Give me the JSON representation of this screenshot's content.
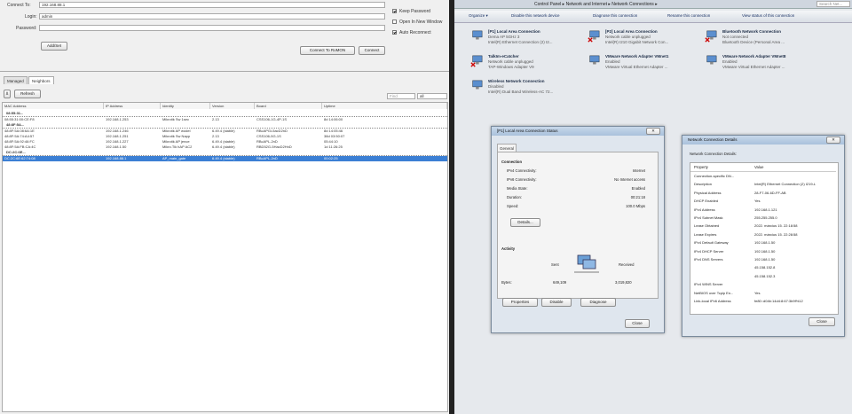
{
  "winbox": {
    "connect_to_label": "Connect To:",
    "connect_to_value": "192.168.88.1",
    "login_label": "Login:",
    "login_value": "admin",
    "password_label": "Password:",
    "password_value": "",
    "add_set_label": "Add/Set",
    "keep_password": "Keep Password",
    "open_new_window": "Open In New Window",
    "auto_reconnect": "Auto Reconnect",
    "connect_romon": "Connect To RoMON",
    "connect": "Connect",
    "tabs": [
      "Managed",
      "Neighbors"
    ],
    "refresh": "Refresh",
    "find_placeholder": "Find",
    "filter_value": "all",
    "columns": [
      "MAC Address",
      "IP Address",
      "Identity",
      "Version",
      "Board",
      "Uptime"
    ],
    "groups": [
      {
        "label": "08:55:31...",
        "rows": [
          {
            "mac": "08:55:31:00:CE:F8",
            "ip": "192.168.1.253",
            "identity": "Mikrotik Sw 1sec",
            "version": "2.13",
            "board": "CSS106-1G-4P-1S",
            "uptime": "8d 14:06:00",
            "selected": false
          }
        ]
      },
      {
        "label": "48:8F:5A...",
        "rows": [
          {
            "mac": "48:8F:5A:08:6A:1E",
            "ip": "192.168.1.246",
            "identity": "Mikrotik AP wodel",
            "version": "6.49.4 (stable)",
            "board": "RBcAPGi-5acD2nD",
            "uptime": "8d 14:05:46",
            "selected": false
          },
          {
            "mac": "48:8F:5A:74:A4:57",
            "ip": "192.168.1.251",
            "identity": "Mikrotik Sw Napp",
            "version": "2.13",
            "board": "CSS106-5G-1S",
            "uptime": "38d 03:50:07",
            "selected": false
          },
          {
            "mac": "48:8F:5A:92:46:FC",
            "ip": "192.168.1.227",
            "identity": "Mikrotik AP jence",
            "version": "6.49.4 (stable)",
            "board": "RBcAPL-2nD",
            "uptime": "05:44:10",
            "selected": false
          },
          {
            "mac": "48:8F:5A:FB:CA:4C",
            "ip": "192.168.1.50",
            "identity": "Mikro.Tik hAP AC2",
            "version": "6.49.4 (stable)",
            "board": "RBD52G-5HacD2HnD",
            "uptime": "1d 11:26:25",
            "selected": false
          }
        ]
      },
      {
        "label": "DC:2C:6E...",
        "rows": [
          {
            "mac": "DC:2C:6E:62:74:08",
            "ip": "192.168.88.1",
            "identity": "AP_main_gate",
            "version": "6.49.4 (stable)",
            "board": "RBcAPL-2nD",
            "uptime": "00:02:25",
            "selected": true
          }
        ]
      }
    ]
  },
  "explorer": {
    "address": "Control Panel  ▸  Network and Internet  ▸  Network Connections  ▸",
    "search_placeholder": "Search Net...",
    "commands": [
      "Organize ▾",
      "Disable this network device",
      "Diagnose this connection",
      "Rename this connection",
      "View status of this connection"
    ],
    "connections": [
      {
        "name": "[P1] Local Area Connection",
        "status": "Dema AP 5GHz 3",
        "device": "Intel(R) Ethernet Connection (2) I2...",
        "error": false
      },
      {
        "name": "[P2] Local Area Connection",
        "status": "Network cable unplugged",
        "device": "Intel(R) I210 Gigabit Network Con...",
        "error": true
      },
      {
        "name": "Bluetooth Network Connection",
        "status": "Not connected",
        "device": "Bluetooth Device (Personal Area ...",
        "error": true
      },
      {
        "name": "TalkIm-eCatcher",
        "status": "Network cable unplugged",
        "device": "TAP-Windows Adapter V9",
        "error": true
      },
      {
        "name": "VMware Network Adapter VMnet1",
        "status": "Enabled",
        "device": "VMware Virtual Ethernet Adapter ...",
        "error": false
      },
      {
        "name": "VMware Network Adapter VMnet8",
        "status": "Enabled",
        "device": "VMware Virtual Ethernet Adapter ...",
        "error": false
      },
      {
        "name": "Wireless Network Connection",
        "status": "Disabled",
        "device": "Intel(R) Dual Band Wireless-AC 72...",
        "error": false
      }
    ]
  },
  "status_dialog": {
    "title": "[P1] Local Area Connection Status",
    "tab": "General",
    "connection_header": "Connection",
    "rows": [
      {
        "k": "IPv4 Connectivity:",
        "v": "Internet"
      },
      {
        "k": "IPv6 Connectivity:",
        "v": "No Internet access"
      },
      {
        "k": "Media State:",
        "v": "Enabled"
      },
      {
        "k": "Duration:",
        "v": "00:21:18"
      },
      {
        "k": "Speed:",
        "v": "100.0 Mbps"
      }
    ],
    "details": "Details...",
    "activity_header": "Activity",
    "sent": "Sent",
    "received": "Received",
    "bytes_label": "Bytes:",
    "bytes_sent": "649,109",
    "bytes_received": "3,019,820",
    "properties": "Properties",
    "disable": "Disable",
    "diagnose": "Diagnose",
    "close": "Close"
  },
  "details_dialog": {
    "title": "Network Connection Details",
    "subtitle": "Network Connection Details:",
    "col_property": "Property",
    "col_value": "Value",
    "rows": [
      {
        "k": "Connection-specific DN...",
        "v": ""
      },
      {
        "k": "Description",
        "v": "Intel(R) Ethernet Connection (2) I219-L"
      },
      {
        "k": "Physical Address",
        "v": "28-F7-06-6D-FF-AB"
      },
      {
        "k": "DHCP Enabled",
        "v": "Yes"
      },
      {
        "k": "IPv4 Address",
        "v": "192.168.1.121"
      },
      {
        "k": "IPv4 Subnet Mask",
        "v": "255.255.255.0"
      },
      {
        "k": "Lease Obtained",
        "v": "2022. március 15. 22:18:58"
      },
      {
        "k": "Lease Expires",
        "v": "2022. március 15. 22:28:58"
      },
      {
        "k": "IPv4 Default Gateway",
        "v": "192.168.1.50"
      },
      {
        "k": "IPv4 DHCP Server",
        "v": "192.168.1.50"
      },
      {
        "k": "IPv4 DNS Servers",
        "v": "192.168.1.50"
      },
      {
        "k": "",
        "v": "45.158.152.8"
      },
      {
        "k": "",
        "v": "45.158.152.3"
      },
      {
        "k": "IPv4 WINS Server",
        "v": ""
      },
      {
        "k": "NetBIOS over Tcpip En...",
        "v": "Yes"
      },
      {
        "k": "Link-local IPv6 Address",
        "v": "fe80::d04b:14d4:8:67:3b9f%12"
      }
    ],
    "close": "Close"
  },
  "colors": {
    "selection": "#3b7fd4",
    "winbox_bg": "#f0f0f0",
    "explorer_bg": "#e6e9ed"
  }
}
